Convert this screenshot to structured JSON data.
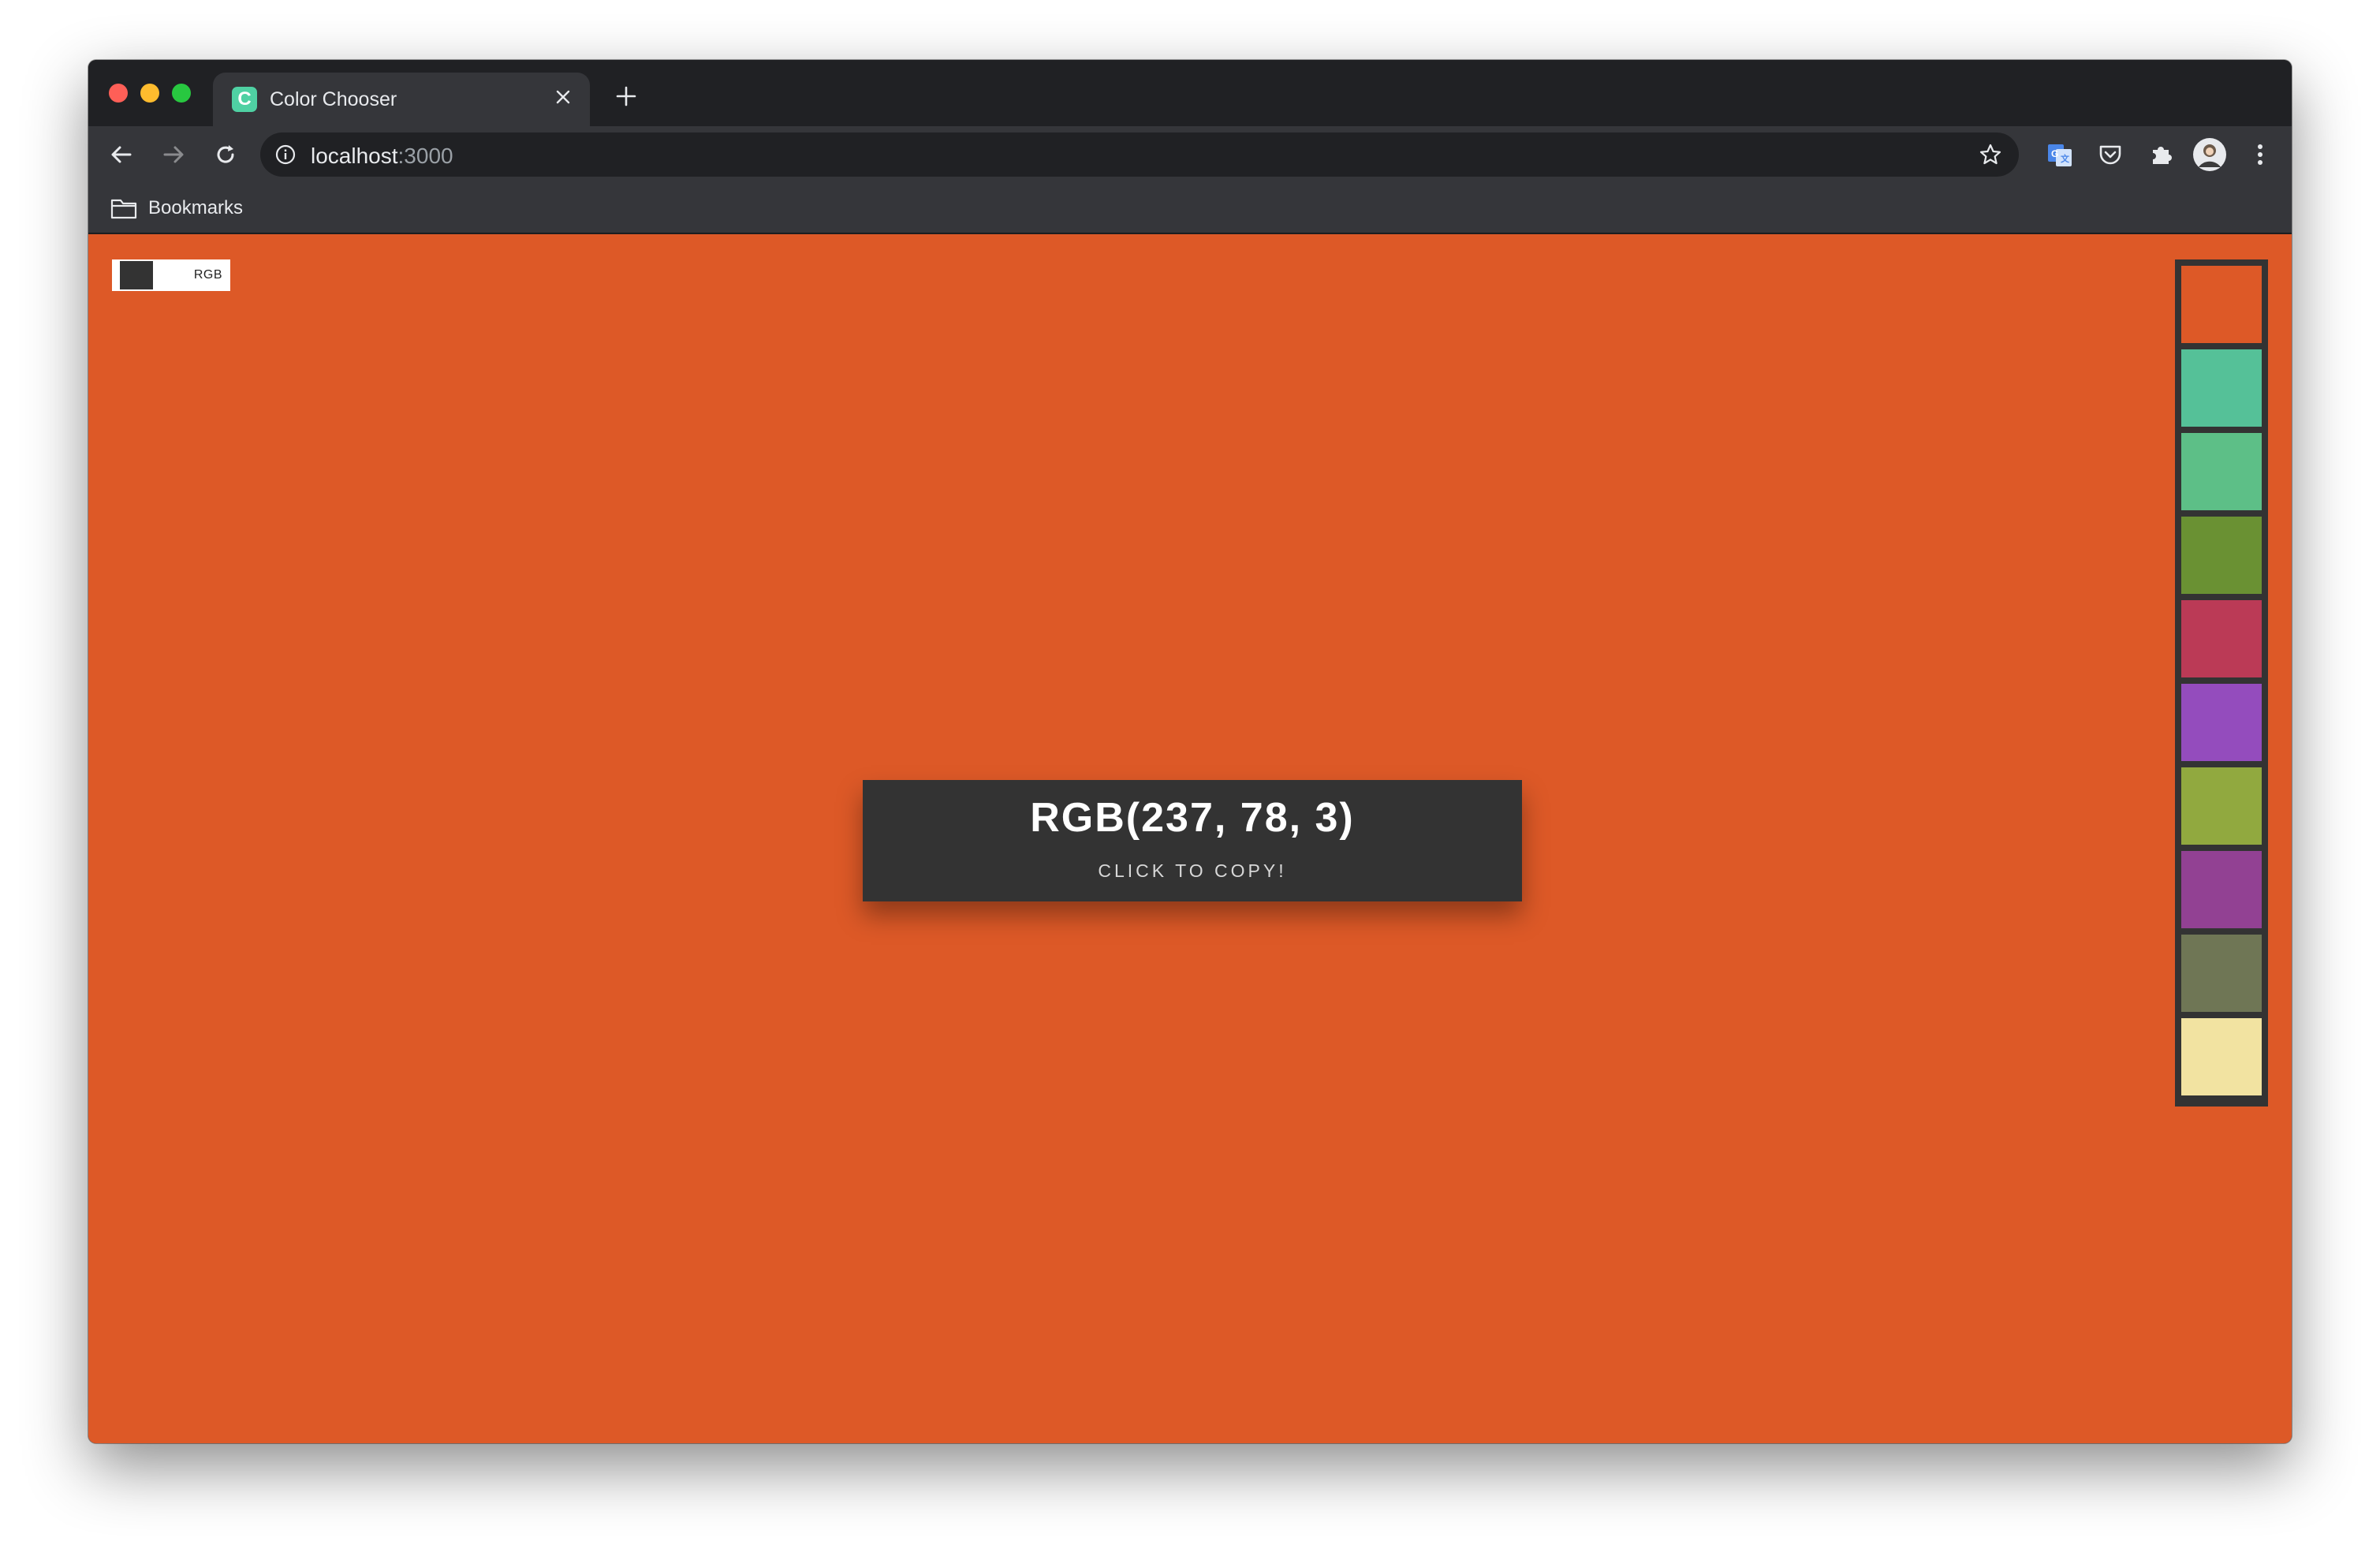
{
  "browser": {
    "tab_title": "Color Chooser",
    "favicon_letter": "C",
    "url_host": "localhost",
    "url_port": ":3000",
    "bookmarks_label": "Bookmarks"
  },
  "app": {
    "background_color": "#dd5927",
    "mode_label": "RGB",
    "current_value": "RGB(237, 78, 3)",
    "copy_hint": "CLICK TO COPY!",
    "swatches": [
      {
        "color": "#dd5927"
      },
      {
        "color": "#55c198"
      },
      {
        "color": "#5dbf87"
      },
      {
        "color": "#6a9133"
      },
      {
        "color": "#bb3a56"
      },
      {
        "color": "#944cbd"
      },
      {
        "color": "#91a93f"
      },
      {
        "color": "#924193"
      },
      {
        "color": "#6f7655"
      },
      {
        "color": "#f2e3a1"
      }
    ]
  }
}
